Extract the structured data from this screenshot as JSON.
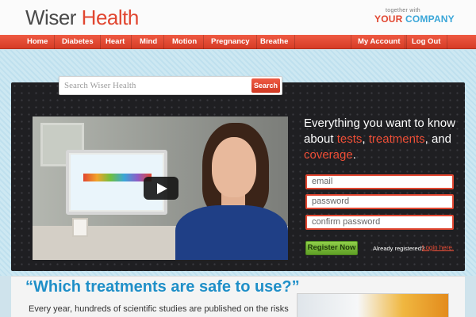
{
  "header": {
    "logo_part1": "Wiser",
    "logo_part2": "Health",
    "partner_small": "together with",
    "partner_your": "YOUR",
    "partner_company": "COMPANY"
  },
  "nav": {
    "items": [
      "Home",
      "Diabetes",
      "Heart",
      "Mind",
      "Motion",
      "Pregnancy",
      "Breathe"
    ],
    "account": "My Account",
    "logout": "Log Out"
  },
  "search": {
    "placeholder": "Search Wiser Health",
    "button": "Search"
  },
  "hero": {
    "line1": "Everything you want to know",
    "about": "about ",
    "tests": "tests",
    "comma": ", ",
    "treatments": "treatments",
    "and": ", and",
    "coverage": "coverage",
    "period": "."
  },
  "form": {
    "email": "email",
    "password": "password",
    "confirm": "confirm password",
    "register": "Register Now",
    "already": "Already registered?",
    "login": "Login here."
  },
  "lower": {
    "question": "“Which treatments are safe to use?”",
    "paragraph": "Every year, hundreds of scientific studies are published on the risks"
  },
  "colors": {
    "brand_red": "#e14630",
    "brand_blue": "#3aa6d8",
    "question_blue": "#1f8fc8",
    "register_green": "#6fb030"
  }
}
